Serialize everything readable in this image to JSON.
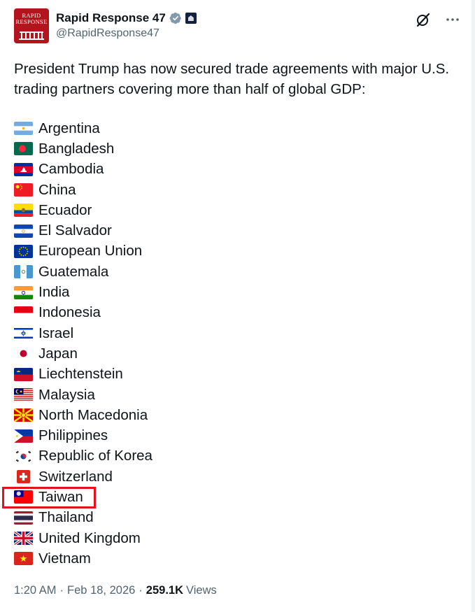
{
  "author": {
    "display_name": "Rapid Response 47",
    "handle": "@RapidResponse47",
    "avatar_text_line1": "RAPID",
    "avatar_text_line2": "RESPONSE",
    "verified_icon": "verified-badge-icon",
    "affiliation_icon": "white-house-affiliate-icon"
  },
  "actions": {
    "grok_icon": "grok-icon",
    "more_icon": "more-horizontal-icon"
  },
  "tweet": {
    "text": "President Trump has now secured trade agreements with major U.S. trading partners covering more than half of global GDP:",
    "countries": [
      {
        "name": "Argentina",
        "flag": "argentina"
      },
      {
        "name": "Bangladesh",
        "flag": "bangladesh"
      },
      {
        "name": "Cambodia",
        "flag": "cambodia"
      },
      {
        "name": "China",
        "flag": "china"
      },
      {
        "name": "Ecuador",
        "flag": "ecuador"
      },
      {
        "name": "El Salvador",
        "flag": "el-salvador"
      },
      {
        "name": "European Union",
        "flag": "eu"
      },
      {
        "name": "Guatemala",
        "flag": "guatemala"
      },
      {
        "name": "India",
        "flag": "india"
      },
      {
        "name": "Indonesia",
        "flag": "indonesia"
      },
      {
        "name": "Israel",
        "flag": "israel"
      },
      {
        "name": "Japan",
        "flag": "japan"
      },
      {
        "name": "Liechtenstein",
        "flag": "liechtenstein"
      },
      {
        "name": "Malaysia",
        "flag": "malaysia"
      },
      {
        "name": "North Macedonia",
        "flag": "north-macedonia"
      },
      {
        "name": "Philippines",
        "flag": "philippines"
      },
      {
        "name": "Republic of Korea",
        "flag": "korea"
      },
      {
        "name": "Switzerland",
        "flag": "switzerland"
      },
      {
        "name": "Taiwan",
        "flag": "taiwan"
      },
      {
        "name": "Thailand",
        "flag": "thailand"
      },
      {
        "name": "United Kingdom",
        "flag": "uk"
      },
      {
        "name": "Vietnam",
        "flag": "vietnam"
      }
    ],
    "highlighted_country": "Taiwan"
  },
  "meta": {
    "time": "1:20 AM",
    "separator": "·",
    "date": "Feb 18, 2026",
    "views_count": "259.1K",
    "views_label": "Views"
  },
  "colors": {
    "text": "#0f1419",
    "secondary": "#536471",
    "highlight": "#e3121b",
    "verified": "#829aab"
  }
}
